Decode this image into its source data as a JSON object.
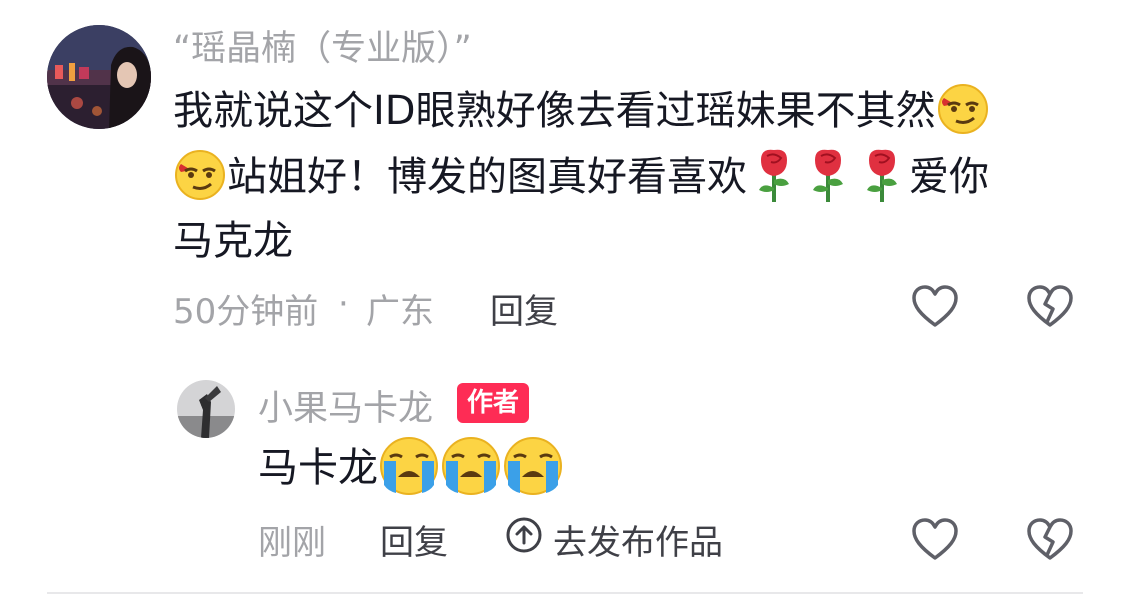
{
  "comment": {
    "username": "“瑶晶楠（专业版）”",
    "text_line1": "我就说这个ID眼熟好像去看过瑶妹果不其然",
    "text_line2a": "站姐好！博发的图真好看喜欢",
    "text_line2b": "爱你",
    "text_line3": "马克龙",
    "time": "50分钟前",
    "dot": "·",
    "location": "广东",
    "reply_label": "回复"
  },
  "reply": {
    "username": "小果马卡龙",
    "badge": "作者",
    "text": "马卡龙",
    "time": "刚刚",
    "reply_label": "回复",
    "publish_label": "去发布作品"
  },
  "colors": {
    "text": "#161823",
    "muted": "#a3a4a8",
    "badge": "#fe2c55"
  }
}
